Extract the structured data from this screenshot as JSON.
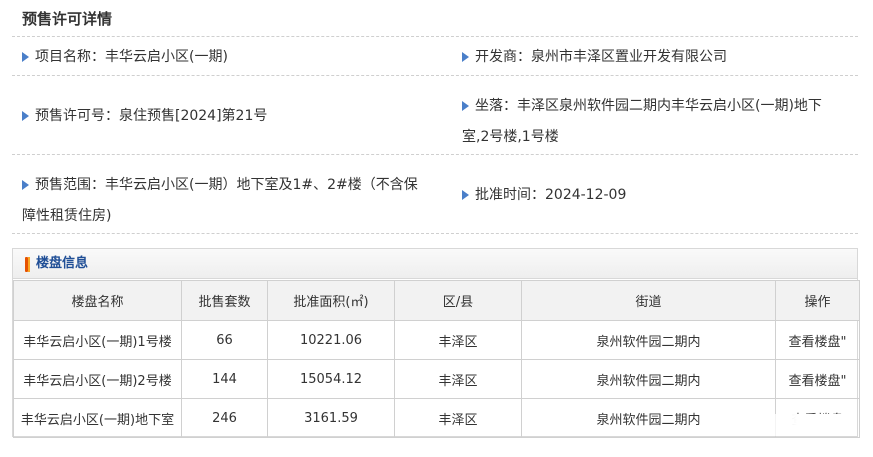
{
  "page_title": "预售许可详情",
  "info": {
    "project_name_label": "项目名称：",
    "project_name": "丰华云启小区(一期)",
    "developer_label": "开发商：",
    "developer": "泉州市丰泽区置业开发有限公司",
    "permit_no_label": "预售许可号：",
    "permit_no": "泉住预售[2024]第21号",
    "location_label": "坐落：",
    "location_line1": "丰泽区泉州软件园二期内丰华云启小区(一期)地下",
    "location_line2": "室,2号楼,1号楼",
    "scope_label": "预售范围：",
    "scope_line1": "丰华云启小区(一期）地下室及1#、2#楼（不含保",
    "scope_line2": "障性租赁住房)",
    "approval_label": "批准时间：",
    "approval_date": "2024-12-09"
  },
  "panel": {
    "title": "楼盘信息",
    "columns": [
      "楼盘名称",
      "批售套数",
      "批准面积(㎡)",
      "区/县",
      "街道",
      "操作"
    ],
    "rows": [
      {
        "name": "丰华云启小区(一期)1号楼",
        "units": "66",
        "area": "10221.06",
        "district": "丰泽区",
        "street": "泉州软件园二期内",
        "action": "查看楼盘\""
      },
      {
        "name": "丰华云启小区(一期)2号楼",
        "units": "144",
        "area": "15054.12",
        "district": "丰泽区",
        "street": "泉州软件园二期内",
        "action": "查看楼盘\""
      },
      {
        "name": "丰华云启小区(一期)地下室",
        "units": "246",
        "area": "3161.59",
        "district": "丰泽区",
        "street": "泉州软件园二期内",
        "action": "查看楼盘"
      }
    ]
  },
  "colors": {
    "accent": "#1f4e96",
    "arrow": "#4a7fc9",
    "marker": "#e65100"
  }
}
